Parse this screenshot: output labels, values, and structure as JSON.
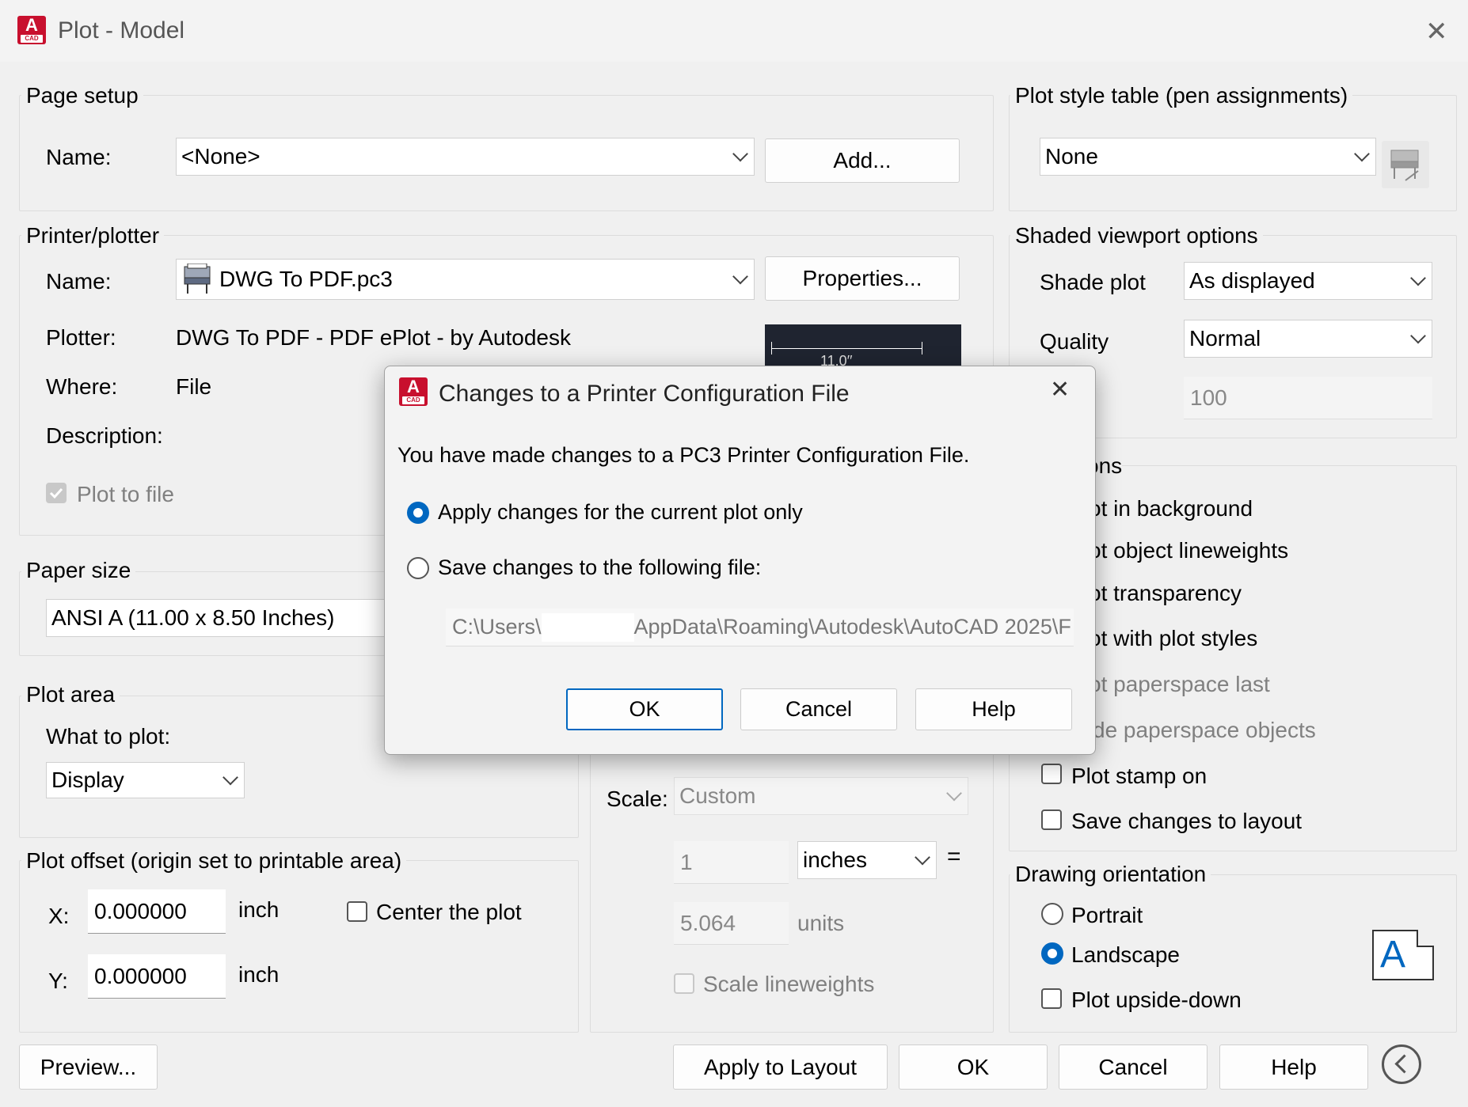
{
  "window": {
    "title": "Plot - Model",
    "close_glyph": "✕",
    "icon_letter": "A",
    "icon_sub": "CAD"
  },
  "page_setup": {
    "label": "Page setup",
    "name_label": "Name:",
    "name_value": "<None>",
    "add_button": "Add..."
  },
  "printer": {
    "label": "Printer/plotter",
    "name_label": "Name:",
    "name_value": "DWG To PDF.pc3",
    "properties_button": "Properties...",
    "plotter_label": "Plotter:",
    "plotter_value": "DWG To PDF - PDF ePlot - by Autodesk",
    "where_label": "Where:",
    "where_value": "File",
    "description_label": "Description:",
    "plot_to_file": "Plot to file",
    "preview_dim": "11.0′′"
  },
  "paper_size": {
    "label": "Paper size",
    "value": "ANSI A (11.00 x 8.50 Inches)"
  },
  "plot_area": {
    "label": "Plot area",
    "what_label": "What to plot:",
    "what_value": "Display"
  },
  "plot_offset": {
    "label": "Plot offset (origin set to printable area)",
    "x_label": "X:",
    "x_value": "0.000000",
    "x_unit": "inch",
    "y_label": "Y:",
    "y_value": "0.000000",
    "y_unit": "inch",
    "center_label": "Center the plot"
  },
  "plot_scale": {
    "scale_label": "Scale:",
    "scale_value": "Custom",
    "value1": "1",
    "unit1": "inches",
    "equals": "=",
    "value2": "5.064",
    "unit2": "units",
    "lineweights": "Scale lineweights"
  },
  "plot_style_table": {
    "label": "Plot style table (pen assignments)",
    "value": "None"
  },
  "shaded_viewport": {
    "label": "Shaded viewport options",
    "shade_label": "Shade plot",
    "shade_value": "As displayed",
    "quality_label": "Quality",
    "quality_value": "Normal",
    "dpi_value": "100"
  },
  "plot_options": {
    "label_partial": "ons",
    "items": [
      "ot in background",
      "ot object lineweights",
      "ot transparency",
      "ot with plot styles",
      "ot paperspace last",
      "de paperspace objects",
      "Plot stamp on",
      "Save changes to layout"
    ]
  },
  "orientation": {
    "label": "Drawing orientation",
    "portrait": "Portrait",
    "landscape": "Landscape",
    "upside_down": "Plot upside-down",
    "icon_letter": "A"
  },
  "footer": {
    "preview": "Preview...",
    "apply_layout": "Apply to Layout",
    "ok": "OK",
    "cancel": "Cancel",
    "help": "Help"
  },
  "modal": {
    "title": "Changes to a Printer Configuration File",
    "close_glyph": "✕",
    "message": "You have made changes to a PC3 Printer Configuration File.",
    "option_apply": "Apply changes for the current plot only",
    "option_save": "Save changes to the following file:",
    "path_prefix": "C:\\Users\\",
    "path_suffix": "AppData\\Roaming\\Autodesk\\AutoCAD 2025\\F",
    "ok": "OK",
    "cancel": "Cancel",
    "help": "Help"
  },
  "colors": {
    "accent": "#0067c0",
    "app_icon": "#c8102e"
  }
}
